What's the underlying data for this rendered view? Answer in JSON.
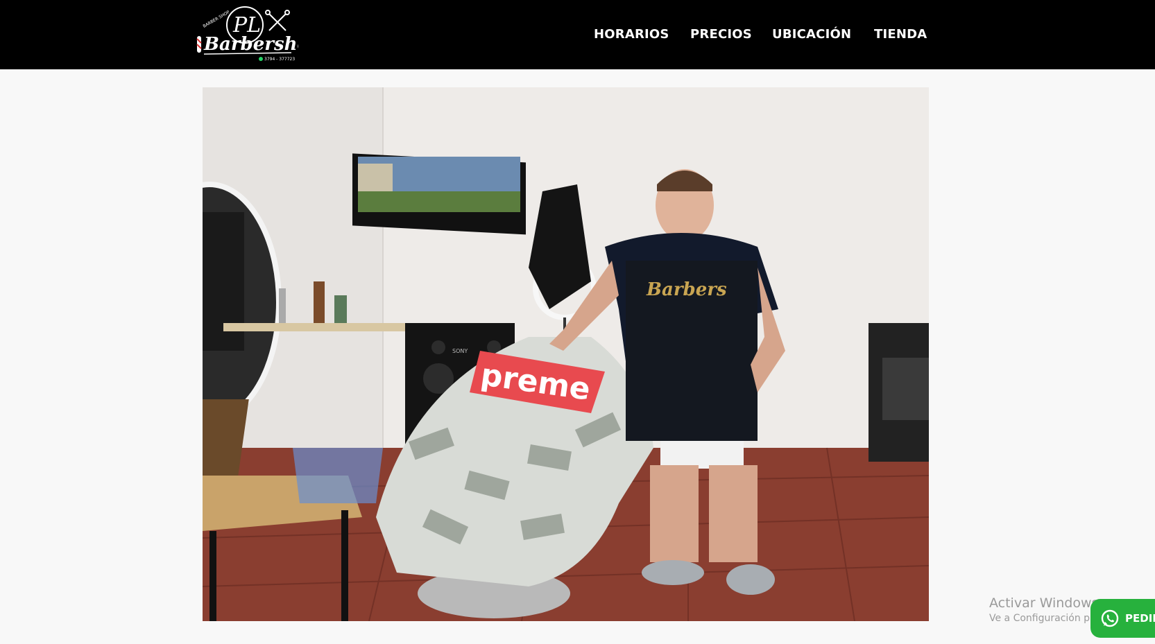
{
  "header": {
    "logo": {
      "monogram": "PL",
      "script_text": "Barbershop",
      "arc_text": "BARBER SHOP",
      "phone": "3794 - 377723",
      "icon": "barber-pole-scissors-logo"
    },
    "nav": [
      {
        "label": "HORARIOS"
      },
      {
        "label": "PRECIOS"
      },
      {
        "label": "UBICACIÓN"
      },
      {
        "label": "TIENDA"
      }
    ]
  },
  "main": {
    "photo": {
      "subject": "barber-shop-interior-photo",
      "cape_text": "preme",
      "apron_text": "Barbers",
      "speaker_brand": "SONY"
    }
  },
  "overlays": {
    "windows_watermark": {
      "line1": "Activar Windows",
      "line2": "Ve a Configuración para"
    },
    "whatsapp_button": {
      "label": "PEDIR",
      "icon": "whatsapp-icon",
      "color": "#27b13d"
    }
  },
  "colors": {
    "header_bg": "#000000",
    "page_bg": "#f8f8f8"
  }
}
